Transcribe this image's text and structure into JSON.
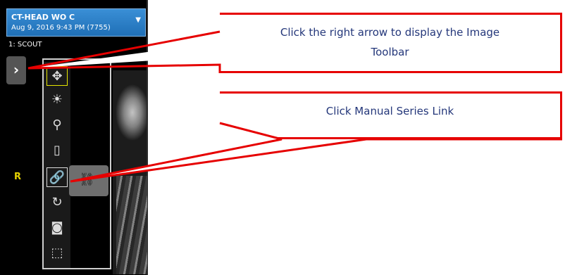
{
  "study": {
    "title": "CT-HEAD WO C",
    "date": "Aug 9, 2016 9:43 PM (7755)"
  },
  "series": {
    "label": "1: SCOUT"
  },
  "viewer": {
    "orientation_label": "R",
    "toolbar_toggle": "›"
  },
  "tools": [
    {
      "name": "pan-icon",
      "glyph": "✥"
    },
    {
      "name": "window-level-icon",
      "glyph": "☀"
    },
    {
      "name": "zoom-icon",
      "glyph": "⚲"
    },
    {
      "name": "ruler-icon",
      "glyph": "▯"
    },
    {
      "name": "link-icon",
      "glyph": "🔗"
    },
    {
      "name": "rotate-icon",
      "glyph": "↻"
    },
    {
      "name": "cine-icon",
      "glyph": "◙"
    },
    {
      "name": "3d-cube-icon",
      "glyph": "⬚"
    }
  ],
  "flyout": {
    "glyph": "⛓"
  },
  "callouts": {
    "toolbar_line1": "Click the right arrow to display the Image",
    "toolbar_line2": "Toolbar",
    "series_link": "Click Manual Series Link"
  },
  "colors": {
    "callout_border": "#e60000",
    "callout_text": "#24377a",
    "header": "#1f6fb6",
    "orientation": "#e6d200"
  }
}
